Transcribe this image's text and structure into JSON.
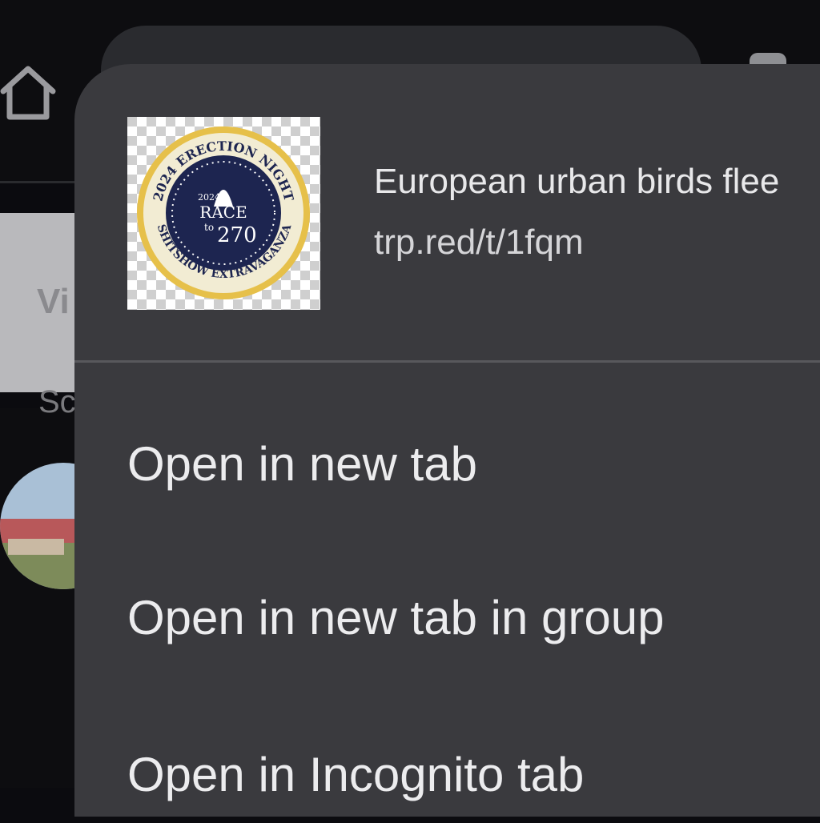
{
  "background": {
    "card_text": "Vi",
    "under_text": "Sc",
    "icons": {
      "home": "home-icon",
      "avatar": "avatar-image"
    }
  },
  "context_menu": {
    "link_title": "European urban birds flee",
    "link_url": "trp.red/t/1fqm",
    "thumbnail": {
      "icon": "badge-logo",
      "top_arc": "2024 ERECTION NIGHT",
      "bottom_arc": "SHITSHOW EXTRAVAGANZA",
      "center_year": "2024",
      "center_line1": "RACE",
      "center_line2": "to",
      "center_line3": "270"
    },
    "items": [
      {
        "label": "Open in new tab"
      },
      {
        "label": "Open in new tab in group"
      },
      {
        "label": "Open in Incognito tab"
      }
    ]
  },
  "colors": {
    "sheet": "#3a3a3e",
    "background": "#0d0d10",
    "text": "#ececee",
    "divider": "#58585c",
    "badge_navy": "#1d2550",
    "badge_gold": "#e6c04a"
  }
}
